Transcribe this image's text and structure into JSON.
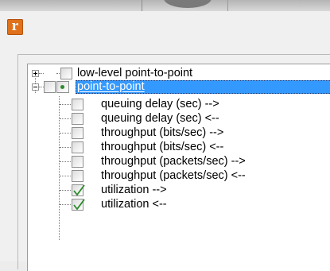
{
  "tree": {
    "root_label": "low-level point-to-point",
    "selected_label": "point-to-point",
    "children": [
      {
        "label": "queuing delay (sec) -->",
        "checked": false
      },
      {
        "label": "queuing delay (sec) <--",
        "checked": false
      },
      {
        "label": "throughput (bits/sec) -->",
        "checked": false
      },
      {
        "label": "throughput (bits/sec) <--",
        "checked": false
      },
      {
        "label": "throughput (packets/sec) -->",
        "checked": false
      },
      {
        "label": "throughput (packets/sec) <--",
        "checked": false
      },
      {
        "label": "utilization -->",
        "checked": true
      },
      {
        "label": "utilization <--",
        "checked": true
      }
    ]
  },
  "app_icon": {
    "glyph": "r",
    "color": "#e0711a"
  },
  "colors": {
    "selection": "#3399ff",
    "check": "#2c8a2c"
  }
}
